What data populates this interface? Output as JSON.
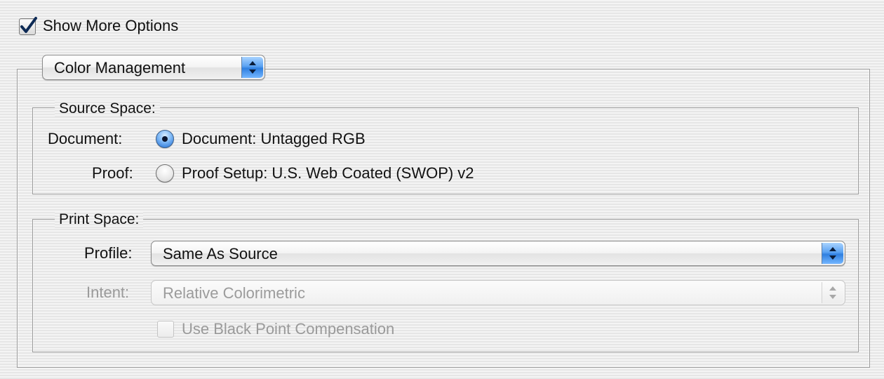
{
  "show_more_options": {
    "label": "Show More Options",
    "checked": true
  },
  "section_popup": {
    "value": "Color Management"
  },
  "source_space": {
    "legend": "Source Space:",
    "document": {
      "row_label": "Document:",
      "option": "Document:  Untagged RGB",
      "selected": true
    },
    "proof": {
      "row_label": "Proof:",
      "option": "Proof Setup:  U.S. Web Coated (SWOP) v2",
      "selected": false
    }
  },
  "print_space": {
    "legend": "Print Space:",
    "profile": {
      "label": "Profile:",
      "value": "Same As Source"
    },
    "intent": {
      "label": "Intent:",
      "value": "Relative Colorimetric",
      "enabled": false
    },
    "black_point": {
      "label": "Use Black Point Compensation",
      "checked": false,
      "enabled": false
    }
  },
  "colors": {
    "accent": "#4a90e8",
    "disabled_text": "#9a9a9a"
  },
  "icons": {
    "checkmark": "checkmark-icon",
    "popup_arrows": "updown-arrows-icon"
  }
}
